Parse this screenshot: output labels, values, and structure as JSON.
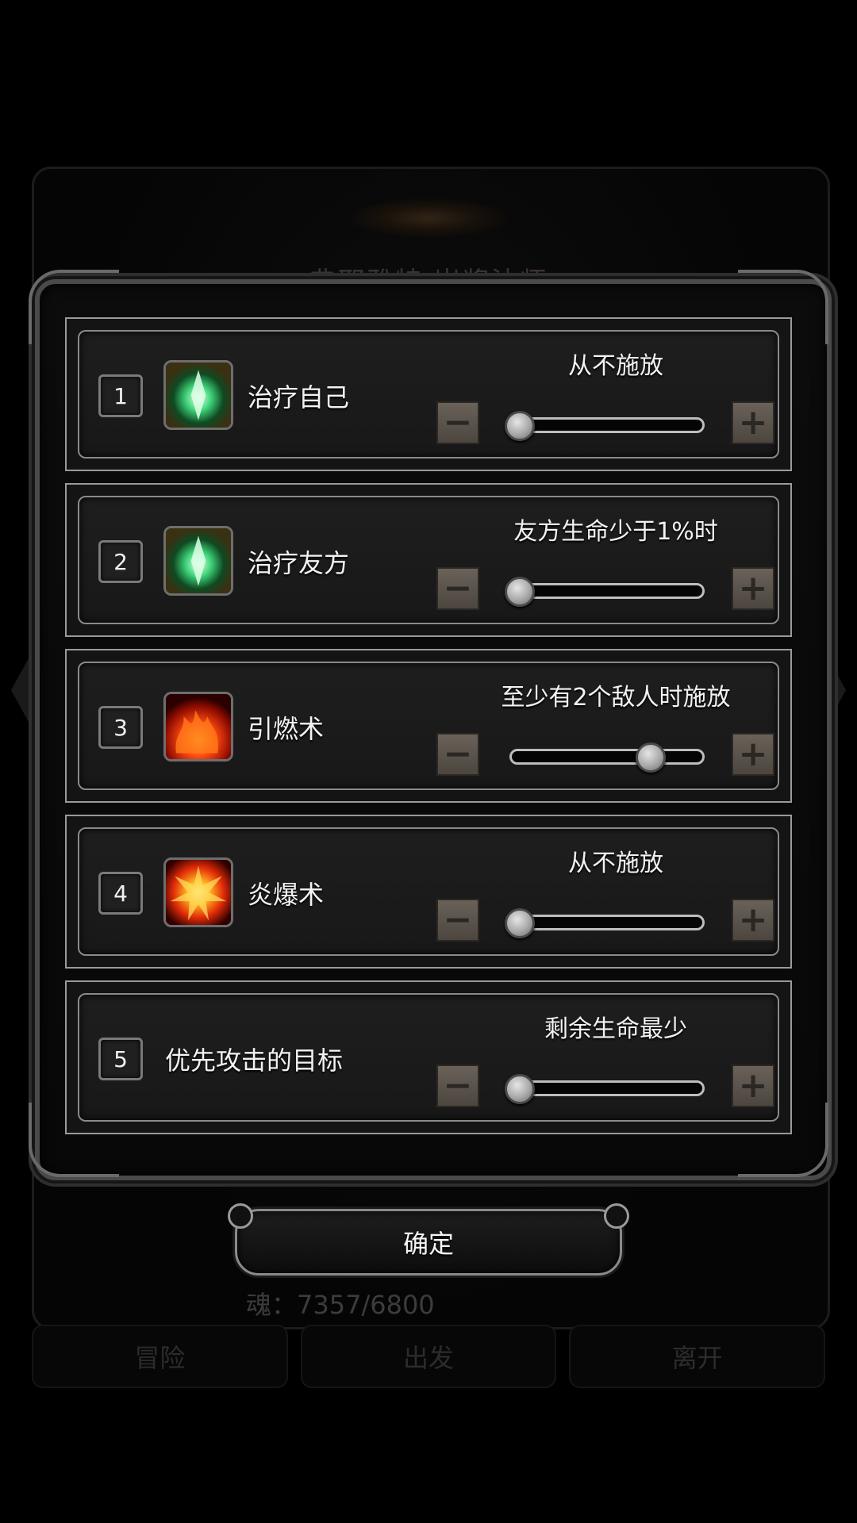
{
  "background": {
    "title": "弗耶雅特 岩浆法师",
    "soul_text": "魂：7357/6800",
    "tabs": [
      "冒险",
      "出发",
      "离开"
    ]
  },
  "rows": [
    {
      "index": "1",
      "name": "治疗自己",
      "icon": "green-crystal-icon",
      "condition": "从不施放",
      "slider_level": 0.0
    },
    {
      "index": "2",
      "name": "治疗友方",
      "icon": "green-crystal-icon",
      "condition": "友方生命少于1%时",
      "slider_level": 0.0
    },
    {
      "index": "3",
      "name": "引燃术",
      "icon": "fire-icon",
      "condition": "至少有2个敌人时施放",
      "slider_level": 0.8
    },
    {
      "index": "4",
      "name": "炎爆术",
      "icon": "fire-burst-icon",
      "condition": "从不施放",
      "slider_level": 0.0
    },
    {
      "index": "5",
      "name": "优先攻击的目标",
      "icon": "",
      "condition": "剩余生命最少",
      "slider_level": 0.0
    }
  ],
  "buttons": {
    "minus": "−",
    "plus": "+",
    "confirm": "确定"
  }
}
